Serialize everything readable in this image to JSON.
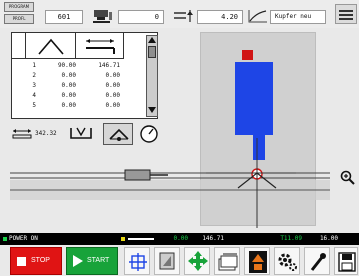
{
  "toolbar": {
    "program_button": "PROGRAM",
    "profile_button": "PROFL",
    "program_number": "601",
    "count_value": "0",
    "thickness_value": "4.20",
    "material_value": "Kupfer neu"
  },
  "tool_table": {
    "rows": [
      {
        "idx": "1",
        "angle": "90.00",
        "length": "146.71"
      },
      {
        "idx": "2",
        "angle": "0.00",
        "length": "0.00"
      },
      {
        "idx": "3",
        "angle": "0.00",
        "length": "0.00"
      },
      {
        "idx": "4",
        "angle": "0.00",
        "length": "0.00"
      },
      {
        "idx": "5",
        "angle": "0.00",
        "length": "0.00"
      }
    ],
    "footer_value": "342.32"
  },
  "status": {
    "power": "POWER ON",
    "v1": "0.00",
    "v2": "146.71",
    "v3": "T11.09",
    "v4": "16.00"
  },
  "buttons": {
    "stop": "STOP",
    "start": "START"
  },
  "colors": {
    "accent_blue": "#1e45e6",
    "stop_red": "#e01414",
    "start_green": "#18a33a",
    "status_green": "#19d14a"
  }
}
